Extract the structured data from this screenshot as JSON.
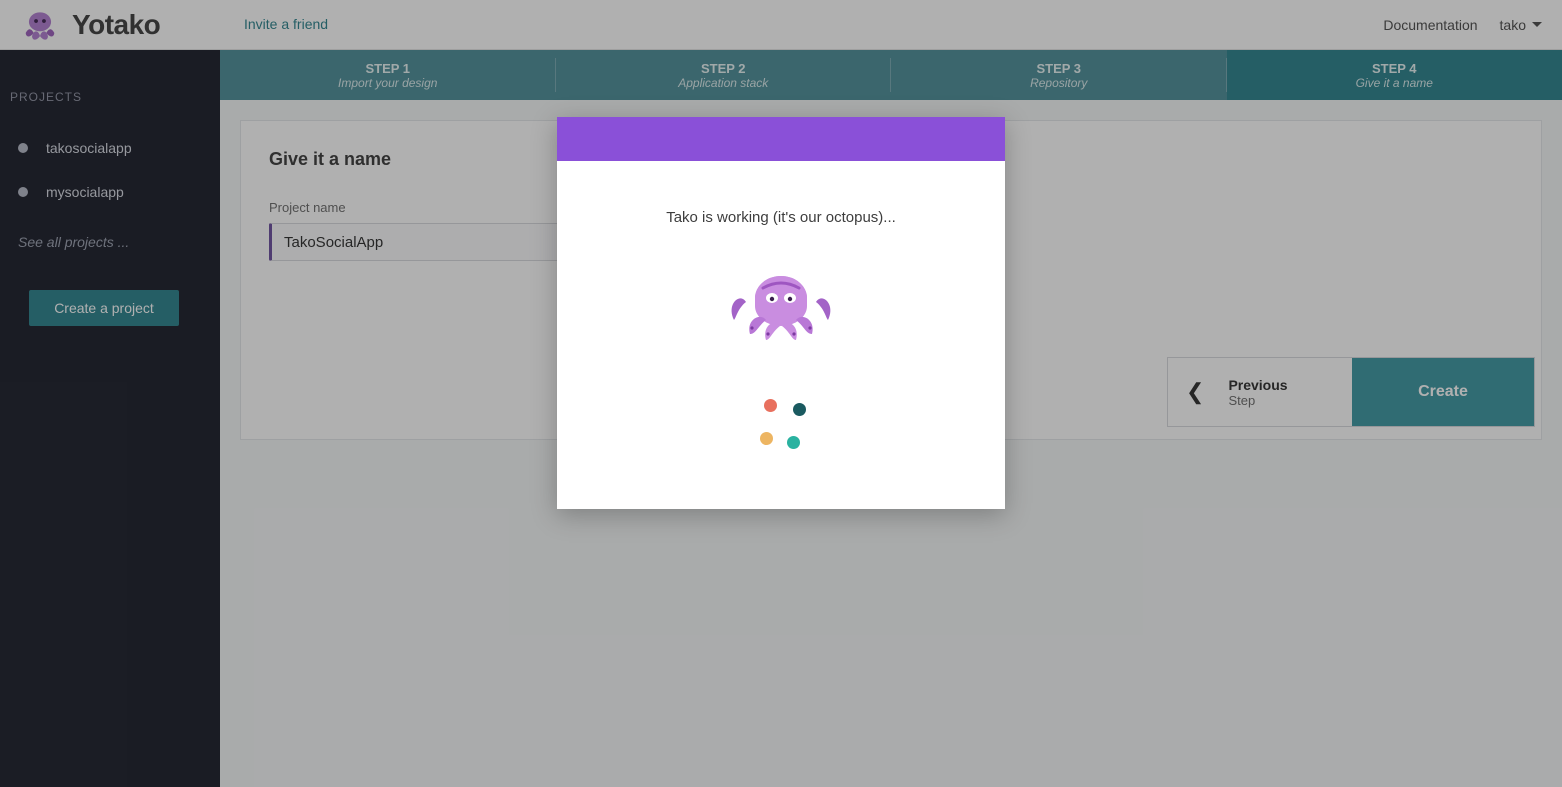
{
  "brand": "Yotako",
  "topnav": {
    "invite_label": "Invite a friend",
    "docs_label": "Documentation",
    "user_label": "tako"
  },
  "sidebar": {
    "heading": "PROJECTS",
    "projects": [
      {
        "name": "takosocialapp"
      },
      {
        "name": "mysocialapp"
      }
    ],
    "see_all_label": "See all projects ...",
    "create_label": "Create a project"
  },
  "steps": [
    {
      "num": "STEP 1",
      "sub": "Import your design",
      "active": false
    },
    {
      "num": "STEP 2",
      "sub": "Application stack",
      "active": false
    },
    {
      "num": "STEP 3",
      "sub": "Repository",
      "active": false
    },
    {
      "num": "STEP 4",
      "sub": "Give it a name",
      "active": true
    }
  ],
  "panel": {
    "title": "Give it a name",
    "project_name_label": "Project name",
    "project_name_value": "TakoSocialApp",
    "prev_line1": "Previous",
    "prev_line2": "Step",
    "create_label": "Create"
  },
  "modal": {
    "message": "Tako is working (it's our octopus)..."
  },
  "colors": {
    "accent_purple": "#8a50d8",
    "accent_teal": "#2a828d"
  }
}
